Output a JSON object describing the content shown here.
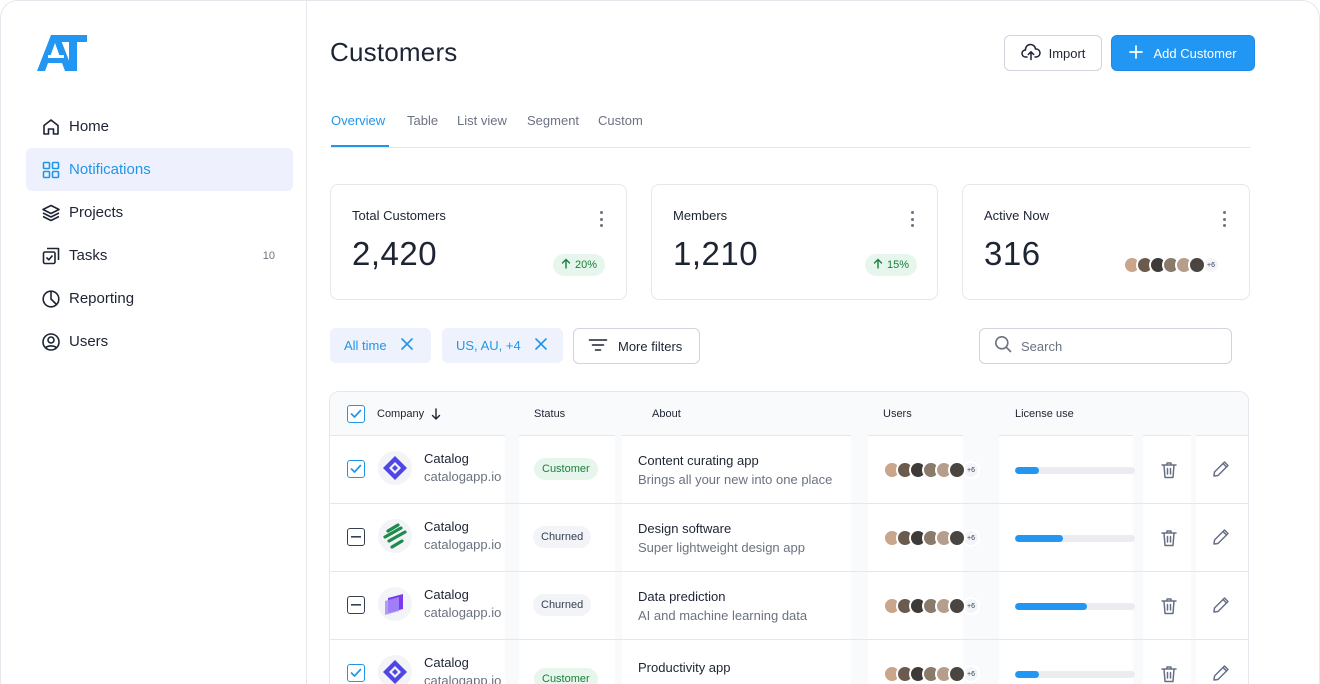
{
  "brand": {
    "logo_text": "AT",
    "accent": "#2196f3"
  },
  "sidebar": {
    "items": [
      {
        "label": "Home",
        "icon": "home-icon",
        "active": false
      },
      {
        "label": "Notifications",
        "icon": "grid-icon",
        "active": true
      },
      {
        "label": "Projects",
        "icon": "layers-icon",
        "active": false
      },
      {
        "label": "Tasks",
        "icon": "check-square-icon",
        "active": false,
        "count": "10"
      },
      {
        "label": "Reporting",
        "icon": "pie-chart-icon",
        "active": false
      },
      {
        "label": "Users",
        "icon": "user-circle-icon",
        "active": false
      }
    ]
  },
  "header": {
    "title": "Customers",
    "import_label": "Import",
    "add_label": "Add Customer"
  },
  "tabs": [
    "Overview",
    "Table",
    "List view",
    "Segment",
    "Custom"
  ],
  "stats": [
    {
      "label": "Total Customers",
      "value": "2,420",
      "trend": "20%"
    },
    {
      "label": "Members",
      "value": "1,210",
      "trend": "15%"
    },
    {
      "label": "Active Now",
      "value": "316",
      "more": "+6"
    }
  ],
  "filters": {
    "chips": [
      "All time",
      "US, AU, +4"
    ],
    "more_label": "More filters",
    "search_placeholder": "Search"
  },
  "table": {
    "columns": [
      "Company",
      "Status",
      "About",
      "Users",
      "License use"
    ],
    "rows": [
      {
        "checked": true,
        "logo": "catalog-logo",
        "name": "Catalog",
        "domain": "catalogapp.io",
        "status": "Customer",
        "about_title": "Content curating app",
        "about_sub": "Brings all your new into one place",
        "users_more": "+6",
        "license": 0.2
      },
      {
        "checked": false,
        "logo": "leaf-logo",
        "name": "Catalog",
        "domain": "catalogapp.io",
        "status": "Churned",
        "about_title": "Design software",
        "about_sub": "Super lightweight design app",
        "users_more": "+6",
        "license": 0.4
      },
      {
        "checked": false,
        "logo": "purple-logo",
        "name": "Catalog",
        "domain": "catalogapp.io",
        "status": "Churned",
        "about_title": "Data prediction",
        "about_sub": "AI and machine learning data",
        "users_more": "+6",
        "license": 0.6
      },
      {
        "checked": true,
        "logo": "catalog-logo",
        "name": "Catalog",
        "domain": "catalogapp.io",
        "status": "Customer",
        "about_title": "Productivity app",
        "about_sub": "",
        "users_more": "+6",
        "license": 0.2
      }
    ]
  }
}
